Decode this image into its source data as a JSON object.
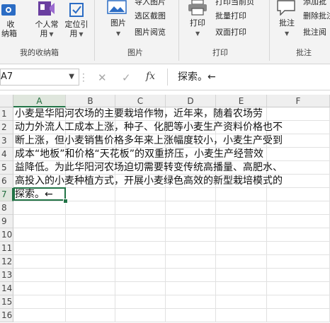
{
  "ribbon": {
    "favorites_btn": {
      "line1": "收",
      "line2": "纳箱"
    },
    "personal_btn": {
      "line1": "个人常",
      "line2": "用"
    },
    "locate_btn": {
      "line1": "定位引",
      "line2": "用"
    },
    "favorites_group": "我的收纳箱",
    "image_btn": "图片",
    "export_image": "导入图片",
    "region_screenshot": "选区截图",
    "image_browse": "图片阅览",
    "image_group": "图片",
    "print_btn": "打印",
    "print_preview": "打印当前页",
    "batch_print": "批量打印",
    "duplex_print": "双面打印",
    "print_group": "打印",
    "annotate_btn": "批注",
    "add_annotation": "添加批",
    "delete_annotation": "删除批注",
    "annotation_reader": "批注阅",
    "annotate_group": "批注"
  },
  "formula_bar": {
    "name_box": "A7",
    "formula": "探索。←"
  },
  "grid": {
    "columns": [
      "A",
      "B",
      "C",
      "D",
      "E",
      "F"
    ],
    "rows": [
      "1",
      "2",
      "3",
      "4",
      "5",
      "6",
      "7",
      "8",
      "9",
      "10",
      "11",
      "12",
      "13",
      "14",
      "15",
      "16"
    ],
    "active_row": "7",
    "active_col": "A",
    "cells": [
      "小麦是华阳河农场的主要栽培作物，近年来，随着农场劳",
      "动力外流人工成本上涨，种子、化肥等小麦生产资料价格也不",
      "断上涨，但小麦销售价格多年来上涨幅度较小，小麦生产受到",
      "成本“地板”和价格“天花板”的双重挤压，小麦生产经营效",
      "益降低。为此华阳河农场迫切需要转变传统高播量、高肥水、",
      "高投入的小麦种植方式，开展小麦绿色高效的新型栽培模式的",
      "探索。←"
    ]
  },
  "colors": {
    "accent": "#217346",
    "ribbon_bg": "#f3f3f3",
    "icon_blue": "#2b6cc4",
    "icon_purple": "#6a3fa0"
  }
}
